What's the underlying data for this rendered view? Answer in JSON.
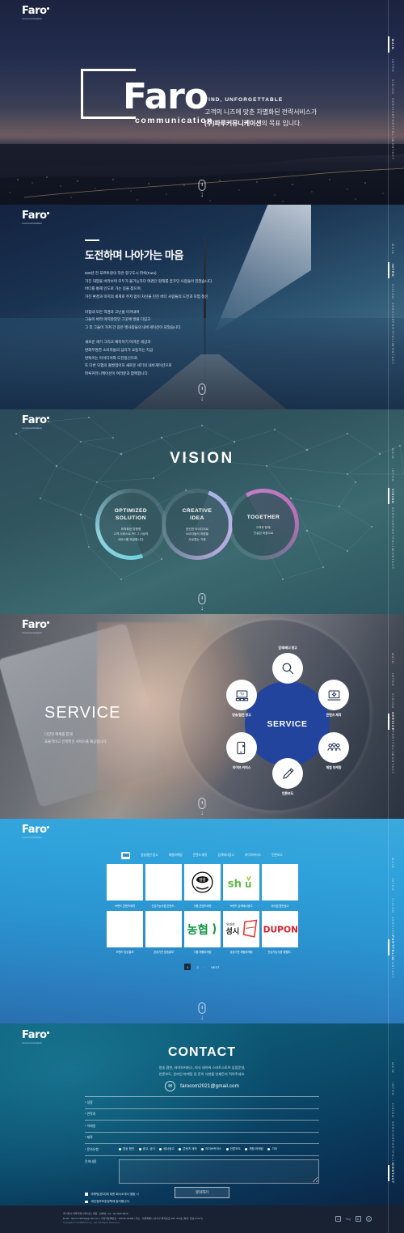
{
  "brand": {
    "name": "Faro",
    "sub": "communication"
  },
  "sidenav": {
    "items": [
      {
        "label": "MAIN"
      },
      {
        "label": "INTRO"
      },
      {
        "label": "VISION"
      },
      {
        "label": "SERVICE"
      },
      {
        "label": "PORTFOLIO"
      },
      {
        "label": "CONTACT"
      }
    ]
  },
  "main": {
    "logo_word": "Faro",
    "logo_sub": "communication",
    "eyebrow": "FIND, UNFORGETTABLE",
    "line1": "고객의 니즈에 맞춘 차별화된 전략서비스가",
    "line2_strong": "(주)파루커뮤니케이션",
    "line2_rest": "의 목표 입니다."
  },
  "intro": {
    "heading": "도전하며 나아가는 마음",
    "p1": "500년 전 포르투갈의 작은 항구도시 파루(Faro)\n거친 대양을 바라보며 모두가 불가능하다 여겼던 항해를 꿈꾸던 사람들이 있었습니다.\n바다를 통해 인도로 가는 길을 찾으며,\n거친 환경과 미지의 세계로 주저 없이 자신을 던진 바다 사람들의 도전과 모험 정신",
    "p2": "마침내 모든 역경과 고난을 이겨내며\n그들이 바라 마지않았던 그곳에 발을 디딛고\n그 후 그들이 거쳐 간 길은 뱃사람들의 내비게이션이 되었습니다.",
    "p3": "새로운 세기 그리고 예측하기 어려운 세상과\n변화무쌍한 소비자들의 심리가 요동치는 지금\n번뜩이는 아이디어와 도전정신으로,\n또 다른 모험의 출발점이자 새로운 세기의 내비게이션으로\n파루커뮤니케이션이 여러분과 함께합니다."
  },
  "vision": {
    "title": "VISION",
    "cards": [
      {
        "title": "OPTIMIZED\nSOLUTION",
        "desc": "최적화된 맞춤형\n고객 서비스로 PR 그 이상의\n서비스를 제공합니다.",
        "accent": "#6fd2dd"
      },
      {
        "title": "CREATIVE\nIDEA",
        "desc": "참신한 아이디어로\n소비자들의 마음을\n사로잡는 기획",
        "accent": "#a9b6e8"
      },
      {
        "title": "TOGETHER",
        "desc": "고객과 함께,\n진실된 마음으로",
        "accent": "#c27fc6"
      }
    ]
  },
  "service": {
    "title": "SERVICE",
    "desc": "다양한 매체를 통해\n효율적이고 전략적인 서비스를 제공합니다.",
    "hub_label": "SERVICE",
    "nodes": [
      {
        "label": "검색/배너 광고",
        "icon": "search-icon",
        "pos": "top"
      },
      {
        "label": "콘텐츠 제작",
        "icon": "laptop-icon",
        "pos": "tr"
      },
      {
        "label": "체험 마케팅",
        "icon": "people-icon",
        "pos": "br"
      },
      {
        "label": "언론보도",
        "icon": "pencil-icon",
        "pos": "bot"
      },
      {
        "label": "라이브 커머스",
        "icon": "mobile-icon",
        "pos": "bl"
      },
      {
        "label": "방송/협찬 광고",
        "icon": "tv-icon",
        "pos": "tl"
      }
    ]
  },
  "portfolio": {
    "tabs": [
      {
        "label": "방송협찬 광고"
      },
      {
        "label": "체험마케팅"
      },
      {
        "label": "콘텐츠 제작"
      },
      {
        "label": "검색배너광고"
      },
      {
        "label": "라이브커머스"
      },
      {
        "label": "언론보도"
      }
    ],
    "items": [
      {
        "caption": "브랜드 콘텐츠제작",
        "logo_text": "",
        "logo_color": "#ffffff"
      },
      {
        "caption": "건강기능식품 콘텐츠...",
        "logo_text": "",
        "logo_color": "#ffffff"
      },
      {
        "caption": "식품 콘텐츠제작",
        "logo_text": "빵빵",
        "logo_color": "#111111"
      },
      {
        "caption": "브랜드 검색배너광고",
        "logo_text": "shu",
        "logo_color": "#5fbb46"
      },
      {
        "caption": "외식업 협찬광고",
        "logo_text": "",
        "logo_color": "#ffffff"
      },
      {
        "caption": "브랜드 방송홍보",
        "logo_text": "",
        "logo_color": "#ffffff"
      },
      {
        "caption": "공공기관 방송홍보",
        "logo_text": "",
        "logo_color": "#ffffff"
      },
      {
        "caption": "식품 체험마케팅",
        "logo_text": "농협",
        "logo_color": "#119944"
      },
      {
        "caption": "공공기관 체험마케팅",
        "logo_text": "성시",
        "logo_color": "#1a1a1a"
      },
      {
        "caption": "건강기능식품 체험마...",
        "logo_text": "DUPONT",
        "logo_color": "#d7202b"
      }
    ],
    "pager": {
      "pages": [
        "1",
        "2"
      ],
      "next": "NEXT",
      "current": "1"
    }
  },
  "contact": {
    "title": "CONTACT",
    "lead": "방송 협찬, 라이브커머스, 지식 네이버 스마트스토어 입점운영,\n언론보도, 온라인 마케팅 등 문의 사항을 언제든지 적어주세요.",
    "email": "farocom2021@gmail.com",
    "fields": [
      {
        "label": "* 성함",
        "value": "",
        "name": "name-field"
      },
      {
        "label": "* 연락처",
        "value": "",
        "name": "phone-field"
      },
      {
        "label": "* 이메일",
        "value": "",
        "name": "email-field"
      },
      {
        "label": "* 제목",
        "value": "",
        "name": "subject-field"
      }
    ],
    "category_label": "* 문의유형",
    "categories": [
      "방송 협찬",
      "광고, 공식",
      "배너광고",
      "콘텐츠 제작",
      "라이브커머스",
      "언론보도",
      "체험 마케팅",
      "기타"
    ],
    "memo_label": "문의내용",
    "memo_value": "",
    "agreements": [
      "마케팅(광고)에 대한 회사소개서 열람 시",
      "개인정보보호정책에 동의합니다."
    ],
    "submit_label": "문의하기"
  },
  "footer": {
    "line1": "주식회사 파루커뮤니케이션  |  대표 : 김예영  |  Tel : 02-2645-8818",
    "line2": "Email : farocom2021@gmail.com  |  사업자등록번호 : 445-86-00468  |  주소 : 서울특별시 강서구 화곡로로 293, 911호 (화곡, 한성 KCVH)",
    "line3": "Copyright © FOMPION Co., Ltd. All Rights Reserved.",
    "social": [
      "naver-icon",
      "blog-label",
      "youtube-icon",
      "instagram-icon"
    ],
    "blog_label": "blog"
  }
}
